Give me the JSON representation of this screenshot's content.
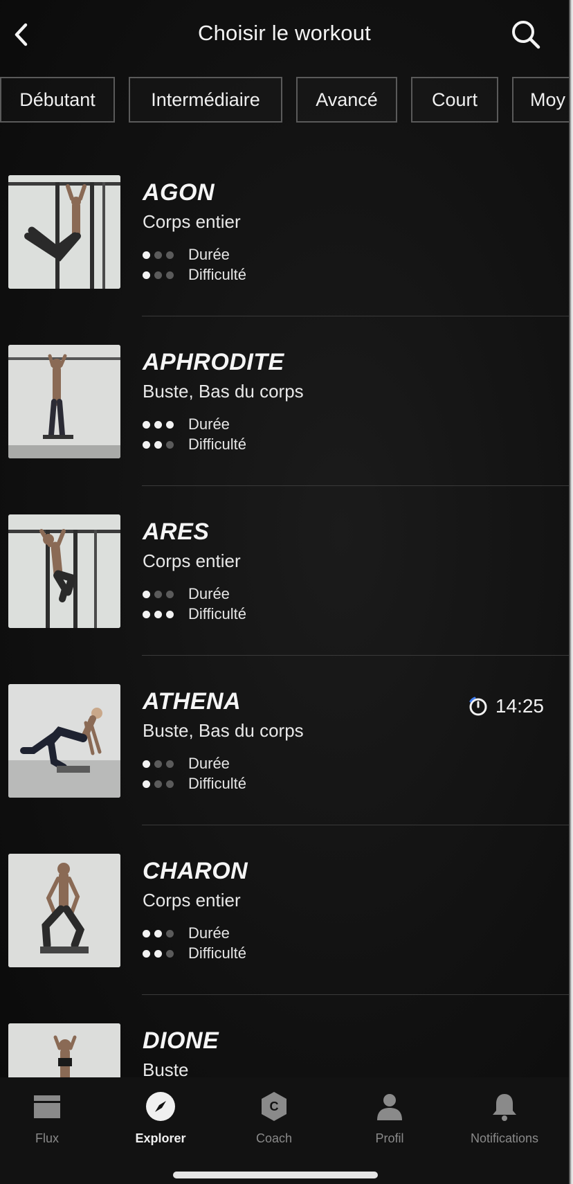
{
  "header": {
    "title": "Choisir le workout",
    "back_icon": "chevron-left-icon",
    "search_icon": "search-icon"
  },
  "filters": [
    "Débutant",
    "Intermédiaire",
    "Avancé",
    "Court",
    "Moy"
  ],
  "labels": {
    "duration": "Durée",
    "difficulty": "Difficulté"
  },
  "workouts": [
    {
      "name": "AGON",
      "subtitle": "Corps entier",
      "duration_level": 1,
      "difficulty_level": 1,
      "timer": null
    },
    {
      "name": "APHRODITE",
      "subtitle": "Buste, Bas du corps",
      "duration_level": 3,
      "difficulty_level": 2,
      "timer": null
    },
    {
      "name": "ARES",
      "subtitle": "Corps entier",
      "duration_level": 1,
      "difficulty_level": 3,
      "timer": null
    },
    {
      "name": "ATHENA",
      "subtitle": "Buste, Bas du corps",
      "duration_level": 1,
      "difficulty_level": 1,
      "timer": "14:25"
    },
    {
      "name": "CHARON",
      "subtitle": "Corps entier",
      "duration_level": 2,
      "difficulty_level": 2,
      "timer": null
    },
    {
      "name": "DIONE",
      "subtitle": "Buste",
      "duration_level": null,
      "difficulty_level": null,
      "timer": null
    }
  ],
  "tabbar": {
    "tabs": [
      {
        "label": "Flux",
        "icon": "feed-icon",
        "active": false
      },
      {
        "label": "Explorer",
        "icon": "compass-icon",
        "active": true
      },
      {
        "label": "Coach",
        "icon": "coach-badge-icon",
        "active": false
      },
      {
        "label": "Profil",
        "icon": "profile-icon",
        "active": false
      },
      {
        "label": "Notifications",
        "icon": "bell-icon",
        "active": false
      }
    ]
  },
  "colors": {
    "background": "#0b0b0b",
    "text": "#f2f2f2",
    "muted": "#8a8a8a",
    "chip_border": "#5a5a5a"
  }
}
